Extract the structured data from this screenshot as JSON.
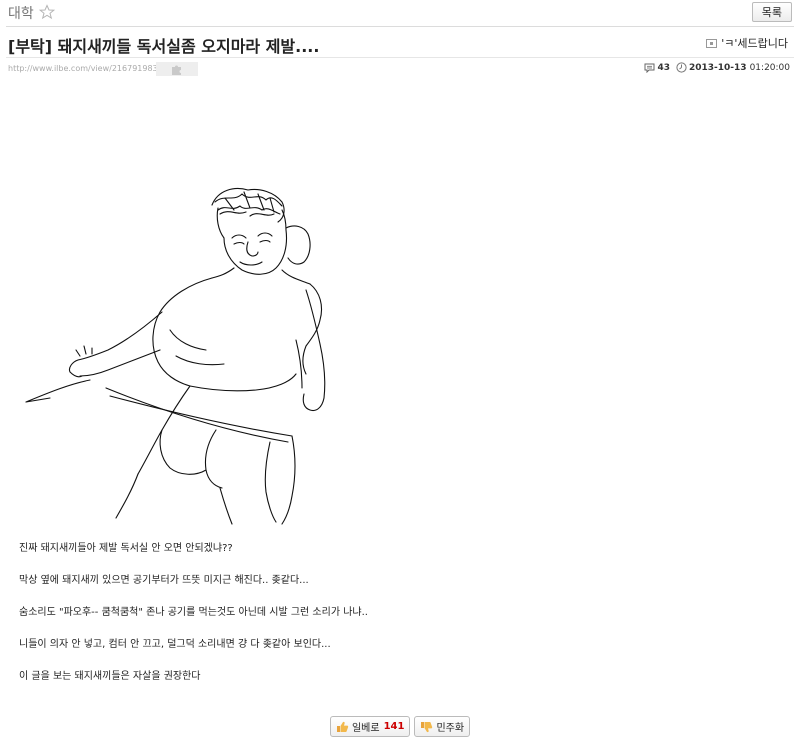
{
  "header": {
    "board_name": "대학",
    "list_button": "목록"
  },
  "post": {
    "title": "[부탁] 돼지새끼들 독서실좀 오지마라 제발....",
    "author": "'ㅋ'세드랍니다",
    "url": "http://www.ilbe.com/view/2167919835",
    "comment_count": "43",
    "date": "2013-10-13",
    "time": "01:20:00",
    "body": [
      "진짜 돼지새끼들아 제발 독서실 안 오면 안되겠냐??",
      "막상 옆에 돼지새끼 있으면 공기부터가 뜨뜻 미지근 해진다.. 좆같다...",
      "숨소리도 \"파오후-- 쿰척쿰척\" 존나 공기를 먹는것도 아닌데 시발 그런 소리가 나냐..",
      "니들이 의자 안 넣고, 컴터 안 끄고, 덜그덕 소리내면 걍 다 좆같아 보인다...",
      "이 글을 보는 돼지새끼들은 자살을 권장한다"
    ]
  },
  "votes": {
    "up_label": "일베로",
    "up_count": "141",
    "down_label": "민주화"
  },
  "icons": {
    "star": "star-outline-icon",
    "author": "author-badge-icon",
    "comment": "comment-bubble-icon",
    "clock": "clock-icon",
    "thumbs_up": "thumbs-up-icon",
    "thumbs_down": "thumbs-down-icon"
  }
}
